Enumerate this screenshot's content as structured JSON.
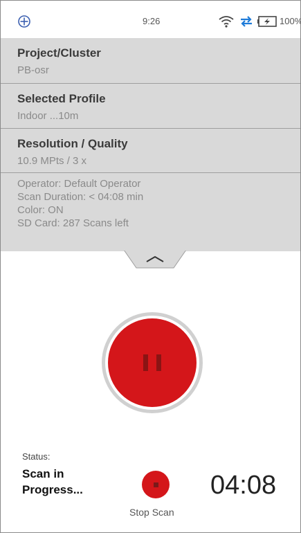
{
  "status_bar": {
    "time": "9:26",
    "battery": "100%",
    "icons": [
      "app-logo-icon",
      "wifi-icon",
      "sync-arrows-icon",
      "battery-charging-icon"
    ]
  },
  "panel": {
    "rows": [
      {
        "title": "Project/Cluster",
        "value": "PB-osr"
      },
      {
        "title": "Selected Profile",
        "value": "Indoor ...10m"
      },
      {
        "title": "Resolution / Quality",
        "value": "10.9 MPts / 3 x"
      }
    ],
    "info": [
      "Operator: Default Operator",
      "Scan Duration: < 04:08 min",
      "Color: ON",
      "SD Card: 287 Scans left"
    ]
  },
  "scan": {
    "status_label": "Status:",
    "status_text": "Scan in Progress...",
    "stop_label": "Stop Scan",
    "timer": "04:08"
  },
  "colors": {
    "accent": "#d4161a",
    "panel_bg": "#d9d9d9",
    "sync_icon": "#1e7bd8"
  }
}
